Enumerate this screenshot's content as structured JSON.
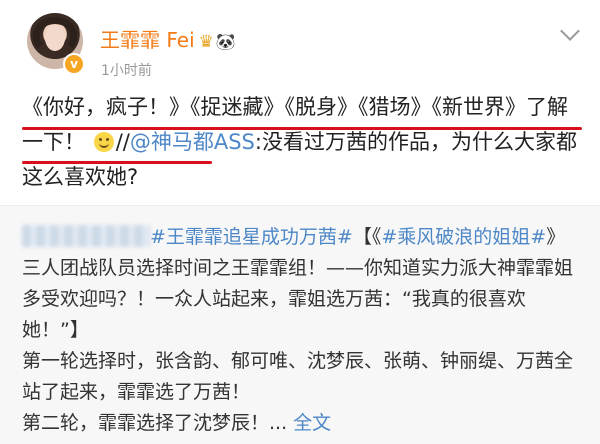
{
  "post": {
    "username": "王霏霏 Fei",
    "crown_icon": "♛",
    "panda_icon": "🐼",
    "verified": "v",
    "time": "1小时前",
    "content_a": "《你好，疯子！》《捉迷藏》《脱身》《猎场》《新世界》了解一下！",
    "content_b": "//",
    "mention": "@神马都ASS",
    "content_c": ":没看过万茜的作品，为什么大家都这么喜欢她?"
  },
  "repost": {
    "hashtag1": "#王霏霏追星成功万茜#",
    "text1": "【《",
    "hashtag2": "#乘风破浪的姐姐#",
    "text2": "》三人团战队员选择时间之王霏霏组！——你知道实力派大神霏霏姐多受欢迎吗？！一众人站起来，霏姐选万茜：“我真的很喜欢她！”】",
    "line2": "第一轮选择时，张含韵、郁可唯、沈梦辰、张萌、钟丽缇、万茜全站了起来，霏霏选了万茜！",
    "line3": "第二轮，霏霏选择了沈梦辰！...",
    "full_text": "全文"
  },
  "colors": {
    "username": "#f37c17",
    "link": "#4d87c7",
    "underline": "#d8101b"
  }
}
